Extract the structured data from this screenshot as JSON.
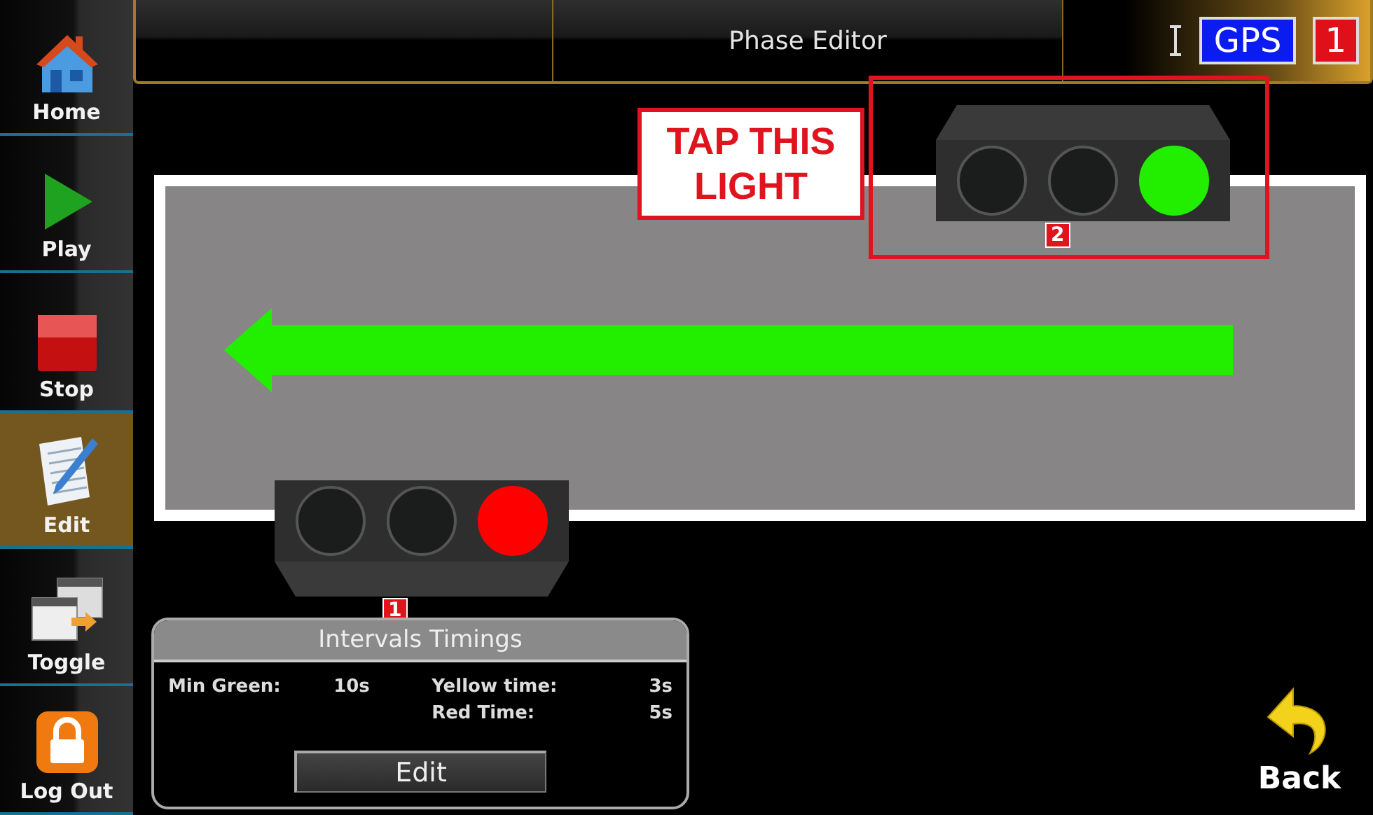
{
  "sidebar": {
    "items": [
      {
        "label": "Home",
        "selected": false
      },
      {
        "label": "Play",
        "selected": false
      },
      {
        "label": "Stop",
        "selected": false
      },
      {
        "label": "Edit",
        "selected": true
      },
      {
        "label": "Toggle",
        "selected": false
      },
      {
        "label": "Log Out",
        "selected": false
      }
    ]
  },
  "header": {
    "title": "Phase Editor",
    "gps_badge": "GPS",
    "count_badge": "1"
  },
  "callout": "TAP THIS LIGHT",
  "lights": [
    {
      "number": "2",
      "kind": "capped-top",
      "highlighted": true,
      "color": "#22ee00",
      "lamps": [
        {
          "on": false
        },
        {
          "on": false
        },
        {
          "on": true
        }
      ]
    },
    {
      "number": "1",
      "kind": "capped-bottom",
      "highlighted": false,
      "color": "#ff0000",
      "lamps": [
        {
          "on": false
        },
        {
          "on": false
        },
        {
          "on": true
        }
      ]
    }
  ],
  "timings": {
    "title": "Intervals Timings",
    "rows": [
      {
        "label": "Min Green:",
        "value": "10s"
      },
      {
        "label": "Yellow time:",
        "value": "3s"
      },
      {
        "label": "Red Time:",
        "value": "5s"
      }
    ],
    "button": "Edit"
  },
  "back_button": "Back"
}
